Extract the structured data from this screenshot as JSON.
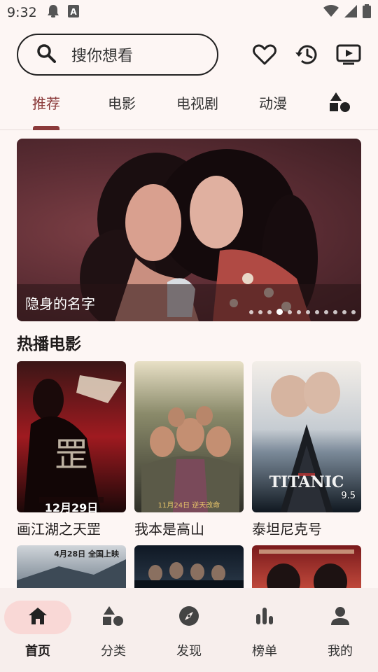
{
  "status_bar": {
    "time": "9:32",
    "left_icons": [
      "notification-icon",
      "text-icon"
    ],
    "right_icons": [
      "wifi-icon",
      "signal-icon",
      "battery-icon"
    ]
  },
  "search": {
    "placeholder": "搜你想看",
    "icons": [
      "search-icon"
    ]
  },
  "header_actions": [
    "favorite-icon",
    "history-icon",
    "cast-icon"
  ],
  "tabs": [
    {
      "label": "推荐",
      "active": true
    },
    {
      "label": "电影"
    },
    {
      "label": "电视剧"
    },
    {
      "label": "动漫"
    },
    {
      "icon": "category-icon"
    }
  ],
  "banner": {
    "title": "隐身的名字",
    "dot_count": 12,
    "active_dot": 3
  },
  "section": {
    "title": "热播电影"
  },
  "movies": [
    {
      "title": "画江湖之天罡",
      "poster_text": "12月29日",
      "colors": [
        "#1a1010",
        "#b51e24"
      ]
    },
    {
      "title": "我本是高山",
      "poster_text": "11月24日 逆天改命",
      "colors": [
        "#d83a23",
        "#3a3a2e"
      ]
    },
    {
      "title": "泰坦尼克号",
      "poster_text": "TITANIC",
      "rating": "9.5",
      "colors": [
        "#dfe3e6",
        "#1d2a38"
      ]
    }
  ],
  "movies_row2": [
    {
      "poster_text": "4月28日 全国上映",
      "colors": [
        "#c7ccd1",
        "#495866"
      ]
    },
    {
      "colors": [
        "#101a26",
        "#2c3a48"
      ]
    },
    {
      "colors": [
        "#7e1c1e",
        "#c94a3c"
      ]
    }
  ],
  "bottom_nav": [
    {
      "label": "首页",
      "icon": "home-icon",
      "active": true
    },
    {
      "label": "分类",
      "icon": "category-icon"
    },
    {
      "label": "发现",
      "icon": "compass-icon"
    },
    {
      "label": "榜单",
      "icon": "chart-icon"
    },
    {
      "label": "我的",
      "icon": "person-icon"
    }
  ],
  "colors": {
    "accent": "#8b3a3a",
    "background": "#fdf6f4",
    "nav_active_pill": "#f9d8d6"
  }
}
